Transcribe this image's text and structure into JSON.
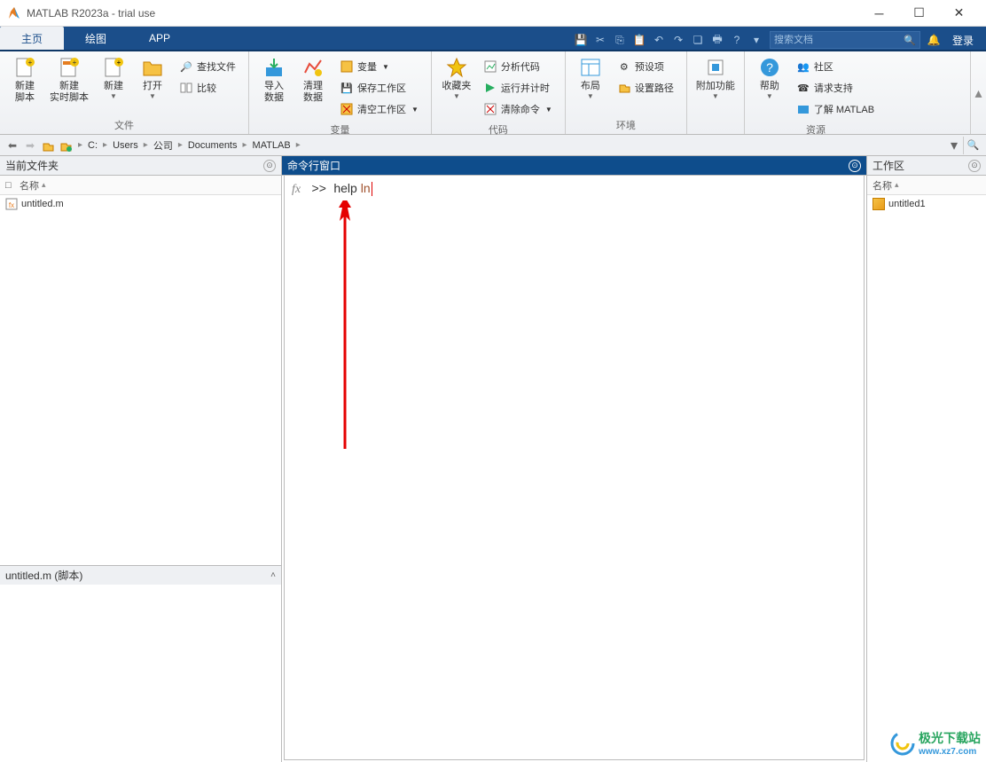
{
  "titlebar": {
    "title": "MATLAB R2023a - trial use"
  },
  "tabs": [
    {
      "label": "主页",
      "active": true
    },
    {
      "label": "绘图",
      "active": false
    },
    {
      "label": "APP",
      "active": false
    }
  ],
  "qat_search": {
    "placeholder": "搜索文档"
  },
  "login_label": "登录",
  "toolstrip": {
    "file": {
      "label": "文件",
      "new_script": "新建\n脚本",
      "new_livescript": "新建\n实时脚本",
      "new": "新建",
      "open": "打开",
      "find_files": "查找文件",
      "compare": "比较"
    },
    "variable": {
      "label": "变量",
      "import_data": "导入\n数据",
      "clean_data": "清理\n数据",
      "variable_btn": "变量",
      "save_workspace": "保存工作区",
      "clear_workspace": "清空工作区"
    },
    "code": {
      "label": "代码",
      "favorites": "收藏夹",
      "analyze": "分析代码",
      "run_time": "运行并计时",
      "clear_cmd": "清除命令"
    },
    "env": {
      "label": "环境",
      "layout": "布局",
      "prefs": "预设项",
      "setpath": "设置路径"
    },
    "addons": {
      "label": "附加功能"
    },
    "resources": {
      "label": "资源",
      "help": "帮助",
      "community": "社区",
      "req_support": "请求支持",
      "learn": "了解 MATLAB"
    }
  },
  "breadcrumbs": [
    "C:",
    "Users",
    "公司",
    "Documents",
    "MATLAB"
  ],
  "panels": {
    "current_folder": {
      "title": "当前文件夹",
      "col_name": "名称",
      "files": [
        {
          "name": "untitled.m"
        }
      ],
      "details_title": "untitled.m (脚本)"
    },
    "command_window": {
      "title": "命令行窗口",
      "prompt": ">>",
      "command": "help",
      "argument": "ln"
    },
    "workspace": {
      "title": "工作区",
      "col_name": "名称",
      "vars": [
        {
          "name": "untitled1"
        }
      ]
    }
  },
  "watermark": {
    "text": "极光下载站",
    "url": "www.xz7.com"
  }
}
